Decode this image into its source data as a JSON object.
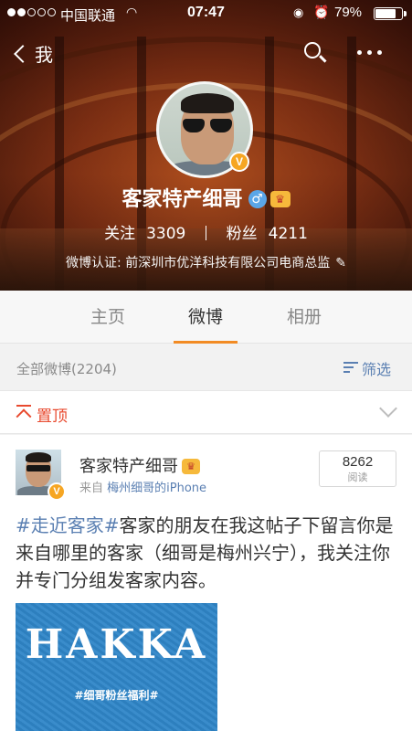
{
  "status_bar": {
    "carrier": "中国联通",
    "time": "07:47",
    "battery": "79%",
    "signal_bars_on": 2,
    "signal_bars_total": 5,
    "battery_level": 0.79
  },
  "nav": {
    "back_label": "我"
  },
  "profile": {
    "name": "客家特产细哥",
    "verified_badge": "V",
    "gender_symbol": "♂",
    "following_label": "关注",
    "following_count": "3309",
    "followers_label": "粉丝",
    "followers_count": "4211",
    "verification": "微博认证: 前深圳市优洋科技有限公司电商总监"
  },
  "tabs": [
    {
      "label": "主页",
      "active": false
    },
    {
      "label": "微博",
      "active": true
    },
    {
      "label": "相册",
      "active": false
    }
  ],
  "filter_bar": {
    "count_text": "全部微博(2204)",
    "filter_label": "筛选"
  },
  "pinned": {
    "label": "置顶"
  },
  "post": {
    "author": "客家特产细哥",
    "source_prefix": "来自",
    "source_device": "梅州细哥的iPhone",
    "read_count": "8262",
    "read_label": "阅读",
    "hashtag": "#走近客家#",
    "body": "客家的朋友在我这帖子下留言你是来自哪里的客家（细哥是梅州兴宁），我关注你并专门分组发客家内容。",
    "image_title": "HAKKA",
    "image_subtitle": "#细哥粉丝福利#"
  },
  "colors": {
    "accent_orange": "#f28b24",
    "link_blue": "#5a7fb2",
    "pin_red": "#e84a2f",
    "vip_gold": "#f6a623"
  }
}
